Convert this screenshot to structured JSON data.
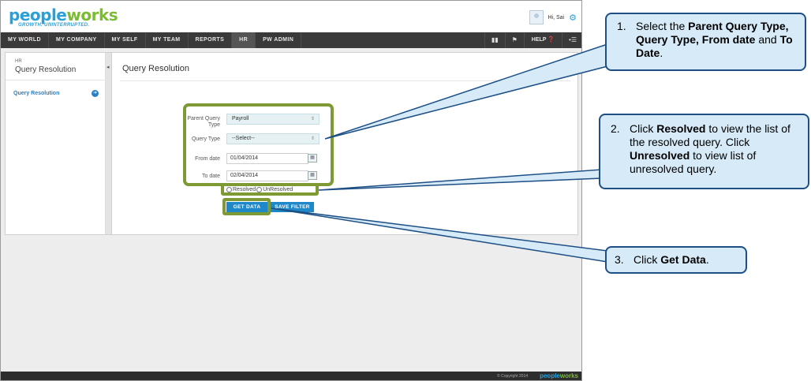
{
  "app": {
    "logo_part1": "people",
    "logo_part2": "works",
    "tagline": "GROWTH. UNINTERRUPTED.",
    "greeting": "Hi, Sai"
  },
  "nav": {
    "items": [
      "MY WORLD",
      "MY COMPANY",
      "MY SELF",
      "MY TEAM",
      "REPORTS",
      "HR",
      "PW ADMIN"
    ],
    "active": "HR",
    "help_label": "HELP"
  },
  "sidebar": {
    "section": "HR",
    "title": "Query Resolution",
    "link": "Query Resolution"
  },
  "page": {
    "title": "Query Resolution"
  },
  "form": {
    "parent_query_type_label": "Parent Query Type",
    "parent_query_type_value": "Payroll",
    "query_type_label": "Query Type",
    "query_type_value": "--Select--",
    "from_date_label": "From date",
    "from_date_value": "01/04/2014",
    "to_date_label": "To date",
    "to_date_value": "02/04/2014",
    "resolved_label": "Resolved",
    "unresolved_label": "UnResolved",
    "get_data_label": "GET DATA",
    "save_filter_label": "SAVE FILTER"
  },
  "footer": {
    "copyright": "© Copyright 2014",
    "logo_part1": "people",
    "logo_part2": "works"
  },
  "callouts": {
    "c1": {
      "num": "1.",
      "t1": "Select the ",
      "b1": "Parent Query Type, Query Type, From date",
      "t2": " and ",
      "b2": "To Date",
      "t3": "."
    },
    "c2": {
      "num": "2.",
      "t1": "Click ",
      "b1": "Resolved",
      "t2": " to view the list of the resolved query. Click ",
      "b2": "Unresolved",
      "t3": " to view list of unresolved query."
    },
    "c3": {
      "num": "3.",
      "t1": "Click ",
      "b1": "Get Data",
      "t2": "."
    }
  },
  "colors": {
    "brand_blue": "#2a9fd8",
    "brand_green": "#7cbc33",
    "button_blue": "#1f88c8",
    "highlight_green": "#7d9a34",
    "callout_border": "#1d4f85",
    "callout_fill": "#d6eaf8"
  }
}
